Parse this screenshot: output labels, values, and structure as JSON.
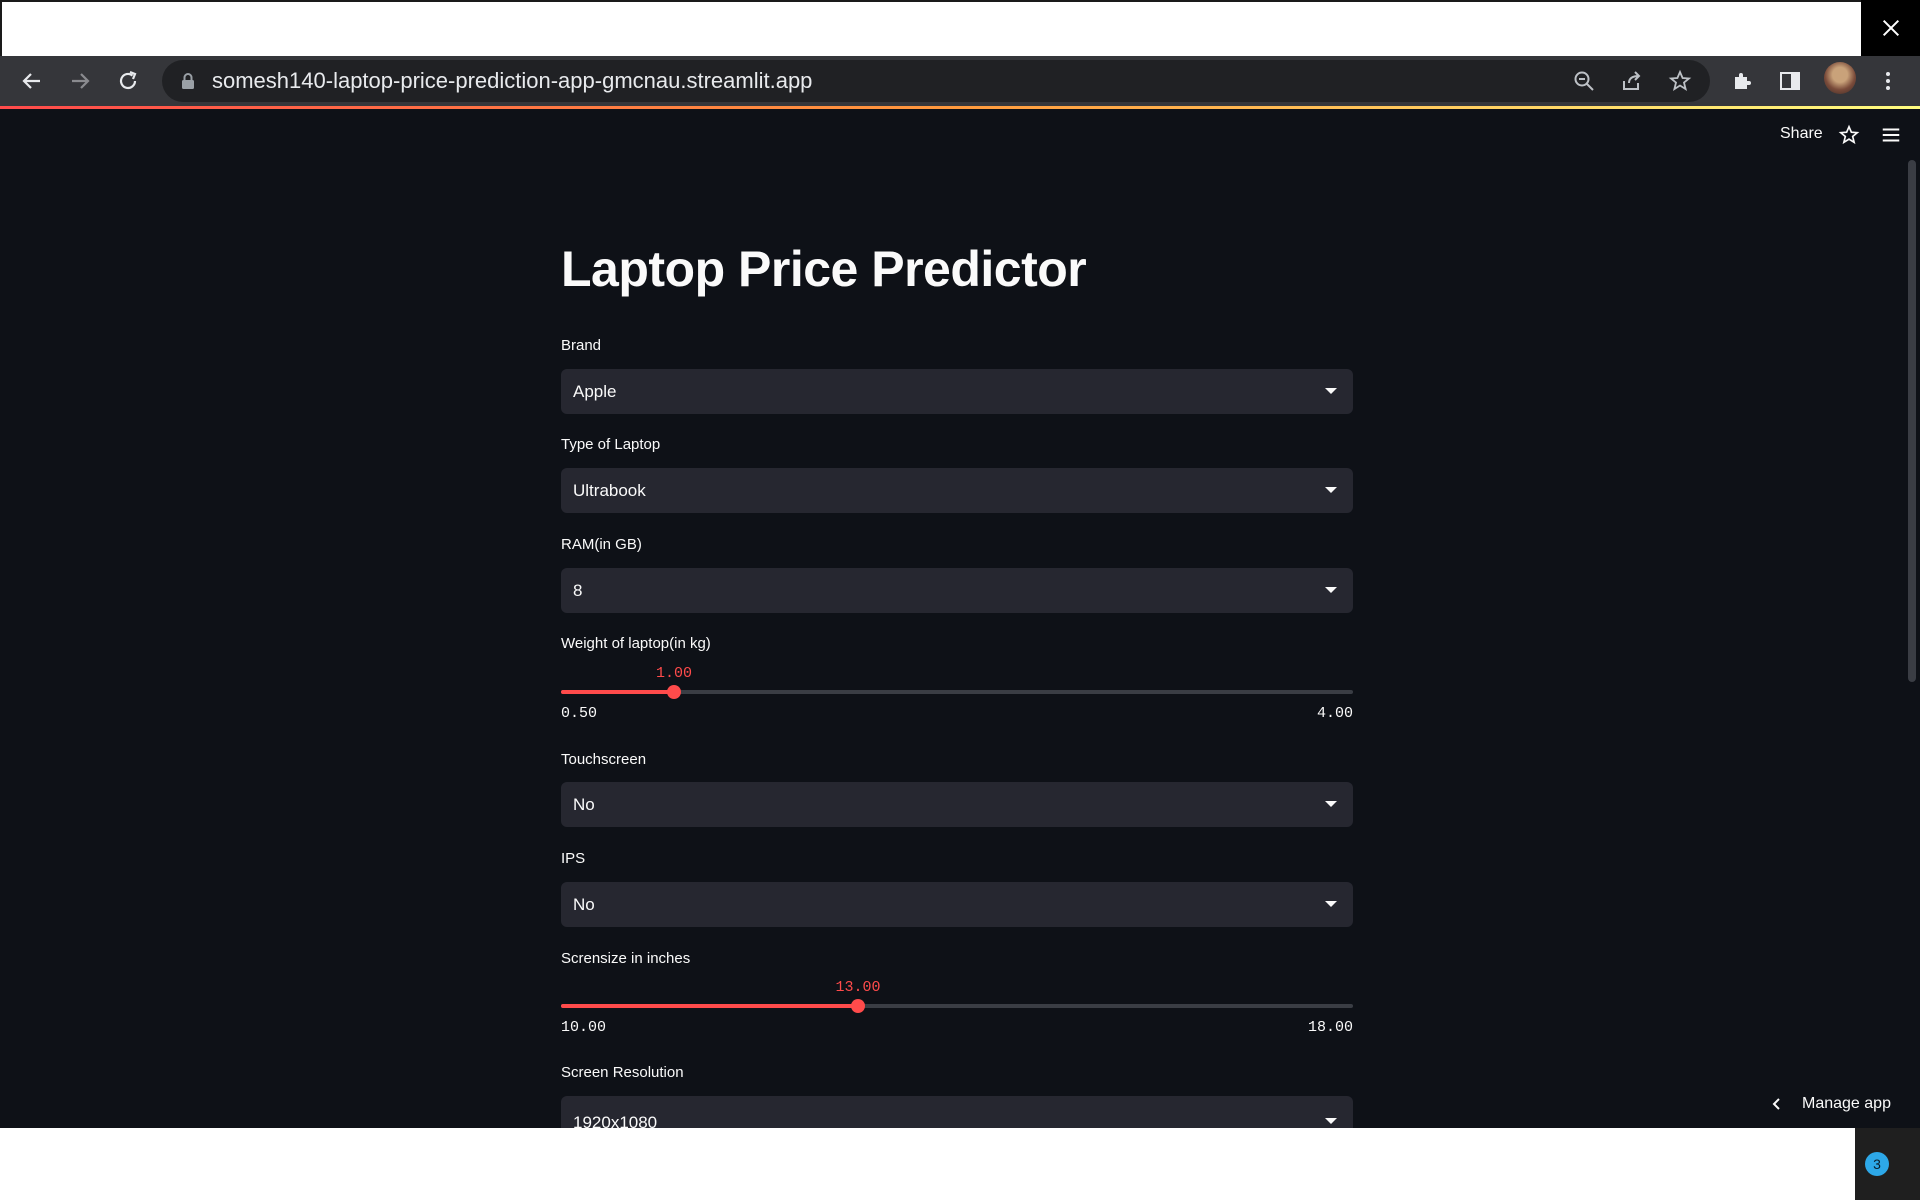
{
  "browser": {
    "url": "somesh140-laptop-price-prediction-app-gmcnau.streamlit.app"
  },
  "header": {
    "share_label": "Share"
  },
  "app": {
    "title": "Laptop Price Predictor",
    "fields": {
      "brand": {
        "label": "Brand",
        "value": "Apple"
      },
      "type": {
        "label": "Type of Laptop",
        "value": "Ultrabook"
      },
      "ram": {
        "label": "RAM(in GB)",
        "value": "8"
      },
      "weight": {
        "label": "Weight of laptop(in kg)",
        "value": "1.00",
        "min": "0.50",
        "max": "4.00",
        "fraction": 0.1429
      },
      "touchscreen": {
        "label": "Touchscreen",
        "value": "No"
      },
      "ips": {
        "label": "IPS",
        "value": "No"
      },
      "screensize": {
        "label": "Scrensize in inches",
        "value": "13.00",
        "min": "10.00",
        "max": "18.00",
        "fraction": 0.375
      },
      "resolution": {
        "label": "Screen Resolution",
        "value": "1920x1080"
      }
    }
  },
  "footer": {
    "manage_label": "Manage app",
    "badge_count": "3"
  },
  "colors": {
    "accent": "#ff4b4b",
    "background": "#0e1117",
    "input_bg": "#262730"
  }
}
